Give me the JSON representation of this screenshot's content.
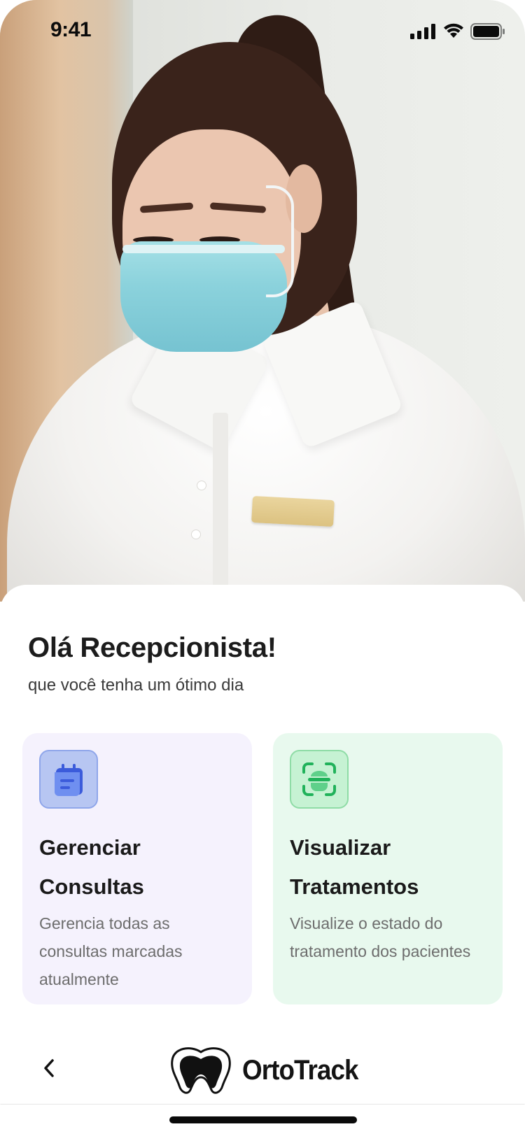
{
  "status_bar": {
    "time": "9:41"
  },
  "hero": {
    "image": "receptionist-photo"
  },
  "greeting": {
    "title": "Olá Recepcionista!",
    "subtitle": "que você tenha um ótimo dia"
  },
  "cards": [
    {
      "title": "Gerenciar Consultas",
      "description": "Gerencia todas as consultas marcadas atualmente",
      "icon": "calendar-icon",
      "color": "#f5f2fd",
      "icon_color": "#3b5bdb"
    },
    {
      "title": "Visualizar Tratamentos",
      "description": "Visualize o estado do tratamento dos pacientes",
      "icon": "scan-icon",
      "color": "#e8f9ee",
      "icon_color": "#20b25a"
    }
  ],
  "footer": {
    "back_icon": "chevron-left-icon",
    "logo_icon": "tooth-icon",
    "brand": "OrtoTrack"
  }
}
